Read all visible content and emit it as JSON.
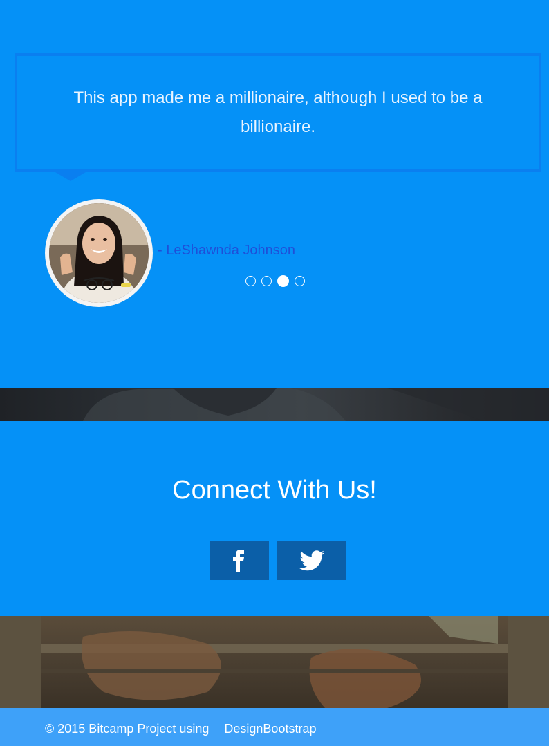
{
  "testimonial": {
    "quote": "This app made me a millionaire, although I used to be a billionaire.",
    "author": "- LeShawnda Johnson",
    "carousel": {
      "total": 4,
      "active_index": 2
    }
  },
  "connect": {
    "title": "Connect With Us!",
    "buttons": [
      {
        "icon": "facebook-icon"
      },
      {
        "icon": "twitter-icon"
      }
    ]
  },
  "footer": {
    "copyright": "© 2015 Bitcamp Project using",
    "link": "DesignBootstrap"
  },
  "colors": {
    "primary_blue": "#0591f7",
    "button_blue": "#0b5fa8",
    "footer_blue": "#3ea1f9",
    "author_blue": "#1f4fd8"
  }
}
